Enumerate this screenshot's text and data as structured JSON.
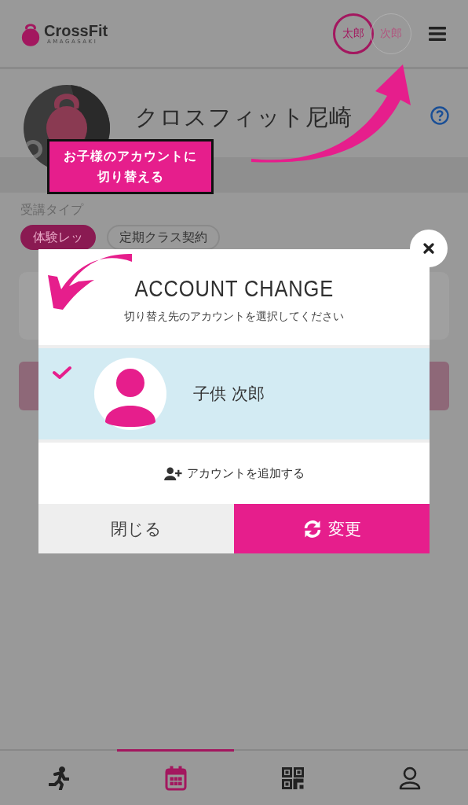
{
  "header": {
    "logo": {
      "name": "CrossFit",
      "subtitle": "AMAGASAKI"
    },
    "accounts": [
      {
        "label": "太郎",
        "selected": true
      },
      {
        "label": "次郎",
        "selected": false
      }
    ]
  },
  "gym": {
    "name": "クロスフィット尼崎"
  },
  "callout": {
    "text": "お子様のアカウントに切り替える"
  },
  "course_type": {
    "label": "受講タイプ",
    "options": [
      {
        "label": "体験レッ",
        "selected": true
      },
      {
        "label": "定期クラス契約",
        "selected": false
      }
    ]
  },
  "modal": {
    "title": "ACCOUNT CHANGE",
    "subtitle": "切り替え先のアカウントを選択してください",
    "accounts": [
      {
        "name": "子供 次郎",
        "selected": true
      }
    ],
    "add_label": "アカウントを追加する",
    "buttons": [
      {
        "label": "閉じる",
        "kind": "secondary"
      },
      {
        "label": "変更",
        "kind": "primary"
      }
    ]
  },
  "nav": [
    {
      "kind": "run",
      "selected": false
    },
    {
      "kind": "calendar",
      "selected": true
    },
    {
      "kind": "qr",
      "selected": false
    },
    {
      "kind": "user",
      "selected": false
    }
  ]
}
